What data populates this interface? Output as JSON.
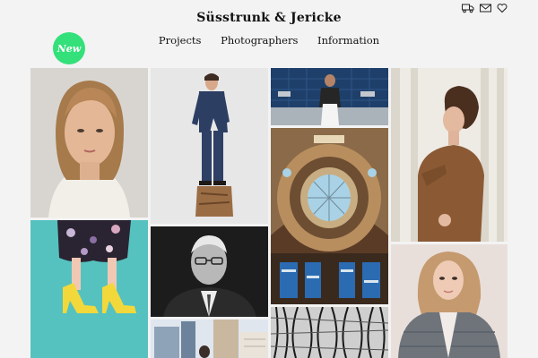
{
  "header": {
    "title": "Süsstrunk & Jericke",
    "badge": "New",
    "nav": [
      {
        "label": "Projects"
      },
      {
        "label": "Photographers"
      },
      {
        "label": "Information"
      }
    ],
    "icons": [
      "truck-icon",
      "mail-icon",
      "heart-icon"
    ]
  },
  "gallery": {
    "items": [
      {
        "name": "portrait-woman-tile"
      },
      {
        "name": "man-in-suit-tile"
      },
      {
        "name": "chef-kitchen-tile"
      },
      {
        "name": "library-dome-tile"
      },
      {
        "name": "woman-profile-tile"
      },
      {
        "name": "yellow-shoes-tile"
      },
      {
        "name": "bw-portrait-man-tile"
      },
      {
        "name": "woman-puffer-jacket-tile"
      },
      {
        "name": "city-buildings-tile"
      },
      {
        "name": "bw-texture-tile"
      }
    ]
  }
}
